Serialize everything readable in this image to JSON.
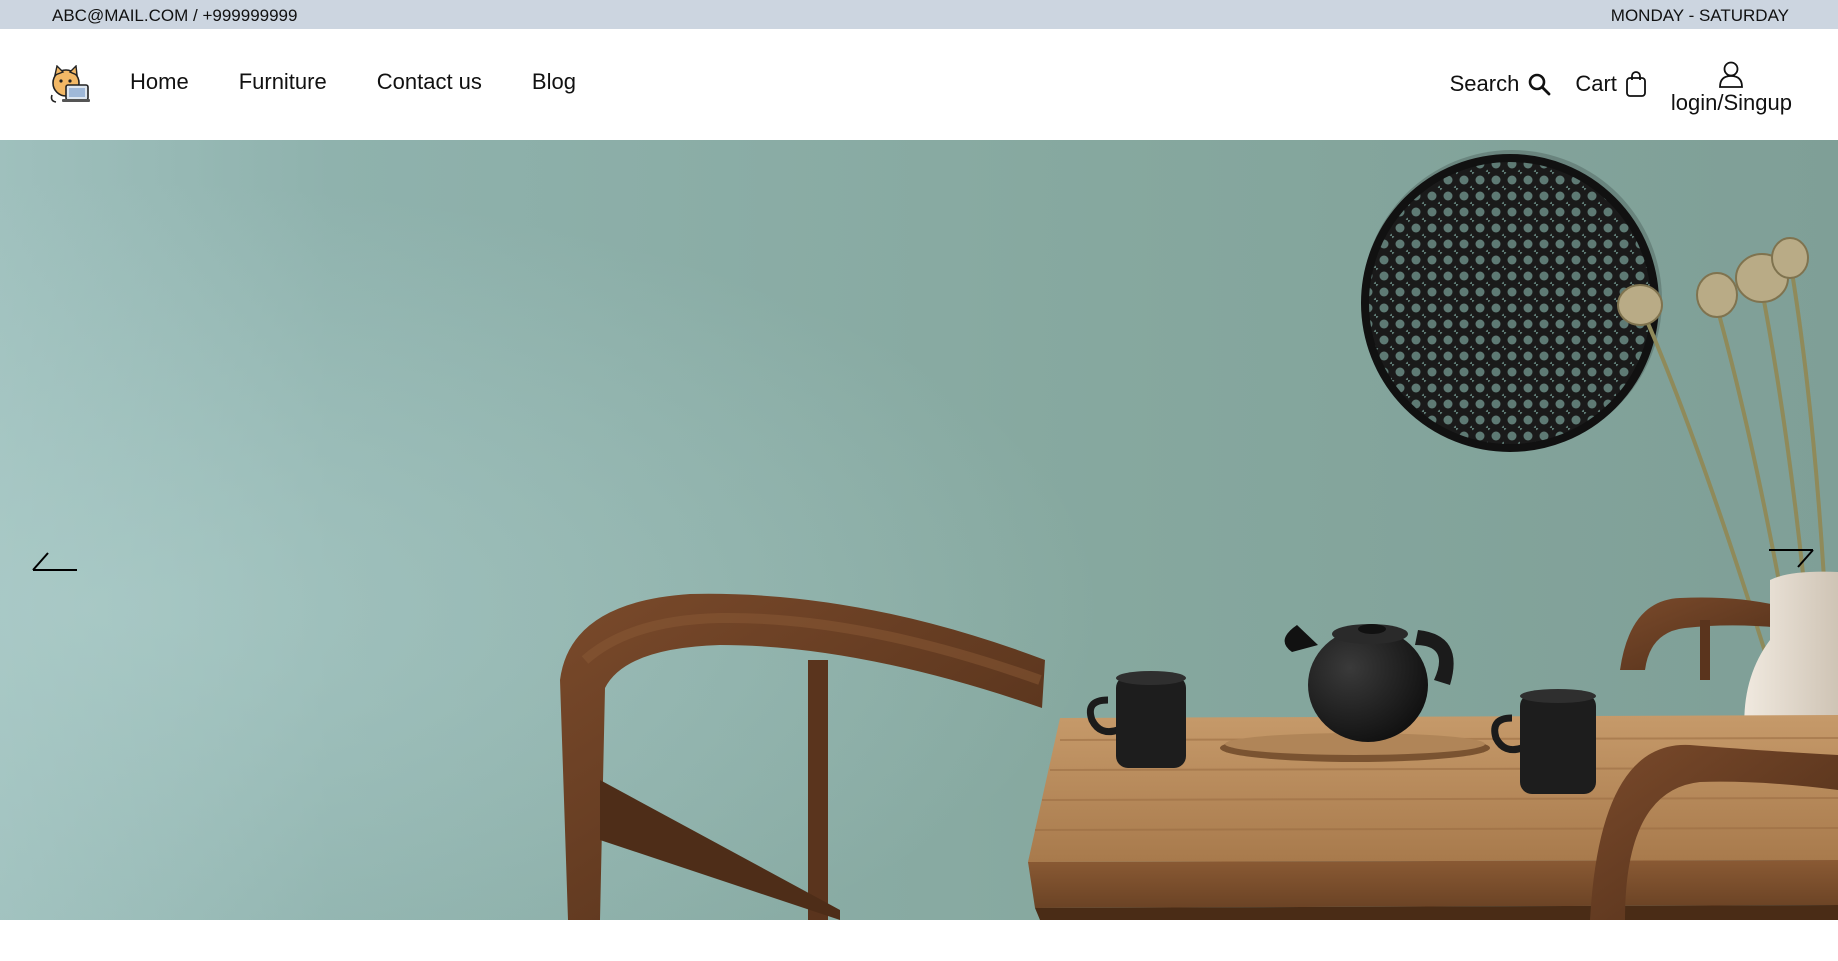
{
  "topbar": {
    "contact": "ABC@MAIL.COM / +999999999",
    "hours": "MONDAY - SATURDAY"
  },
  "nav": {
    "logo_icon": "cat-laptop-logo-icon",
    "links": [
      {
        "label": "Home"
      },
      {
        "label": "Furniture"
      },
      {
        "label": "Contact us"
      },
      {
        "label": "Blog"
      }
    ]
  },
  "actions": {
    "search_label": "Search",
    "search_icon": "search-icon",
    "cart_label": "Cart",
    "cart_icon": "shopping-bag-icon",
    "login_label": "login/Singup",
    "login_icon": "user-icon"
  },
  "hero": {
    "image": "dining-room-teal-wall-photo",
    "prev_icon": "arrow-left-icon",
    "next_icon": "arrow-right-icon"
  },
  "colors": {
    "topbar_bg": "#ccd5e0",
    "wall": "#8aaba5",
    "wood": "#a5754a"
  }
}
